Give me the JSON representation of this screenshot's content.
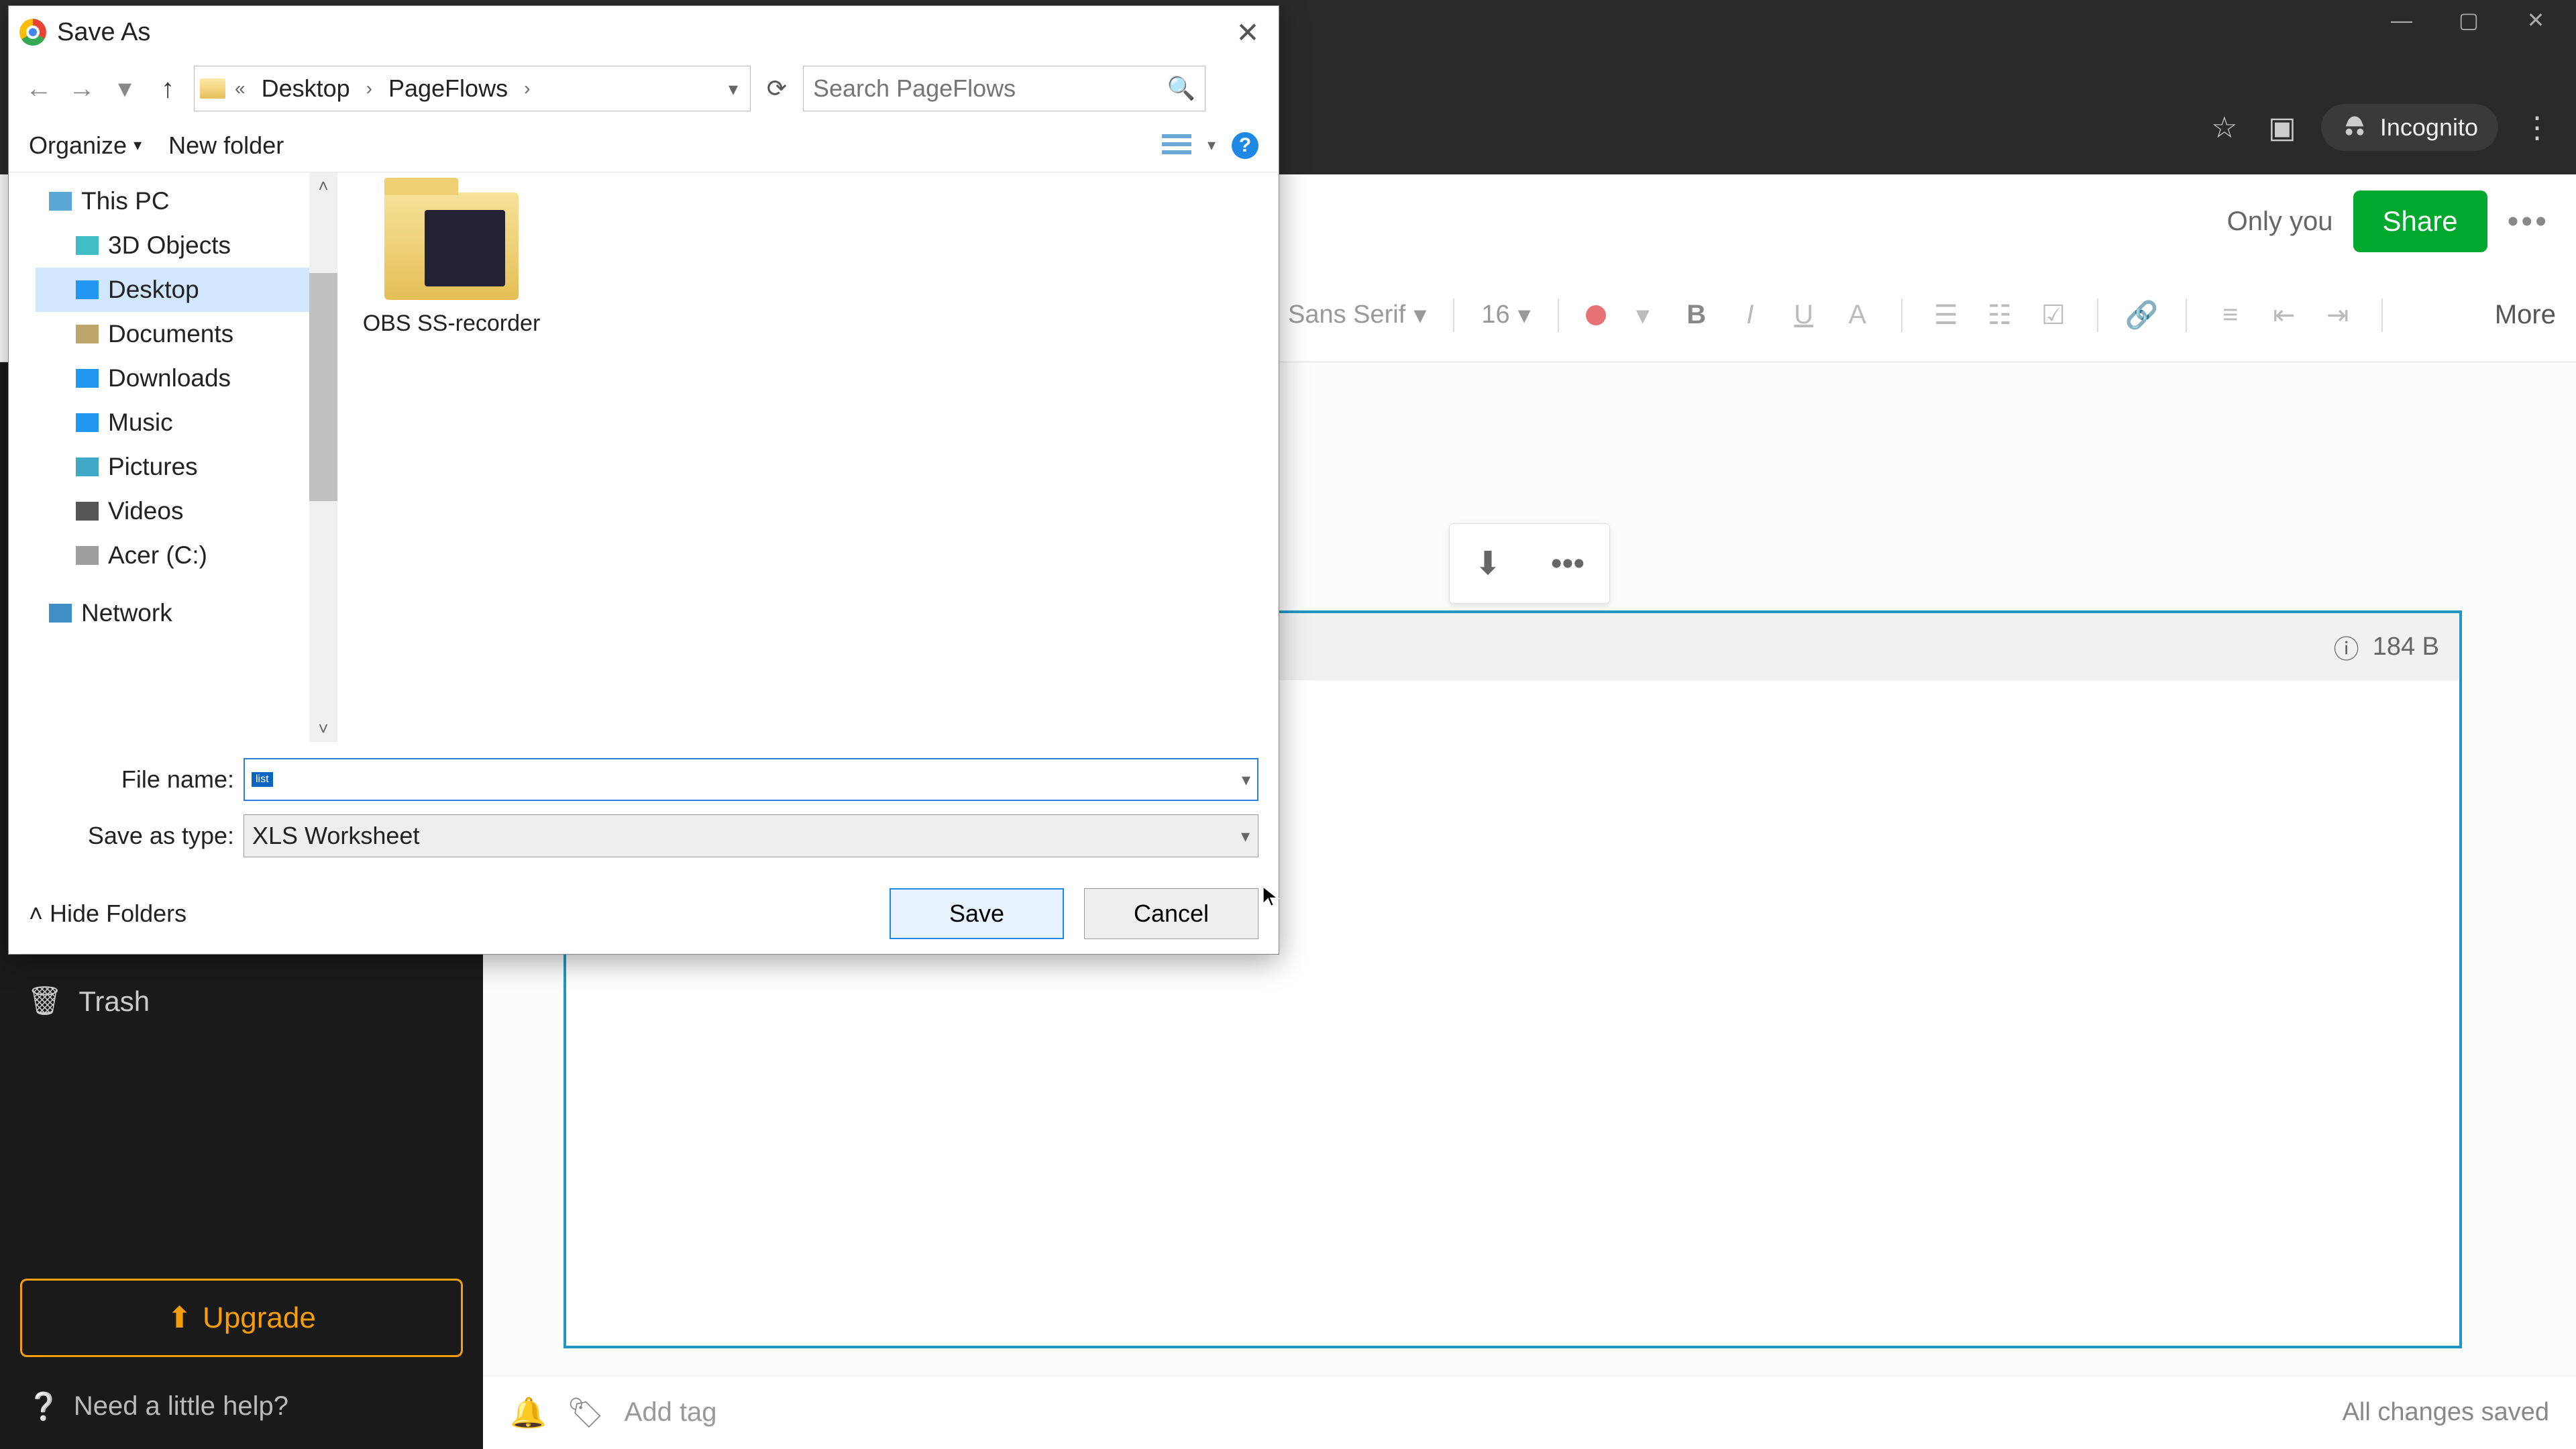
{
  "browser": {
    "incognito_label": "Incognito"
  },
  "app": {
    "only_you": "Only you",
    "share": "Share",
    "font_family": "Sans Serif",
    "font_size": "16",
    "more": "More",
    "attach_size": "184 B",
    "add_tag_placeholder": "Add tag",
    "saved_status": "All changes saved"
  },
  "sidebar": {
    "trash": "Trash",
    "upgrade": "Upgrade",
    "help": "Need a little help?"
  },
  "dialog": {
    "title": "Save As",
    "breadcrumbs": {
      "b1": "Desktop",
      "b2": "PageFlows"
    },
    "search_placeholder": "Search PageFlows",
    "organize": "Organize",
    "new_folder": "New folder",
    "tree": {
      "this_pc": "This PC",
      "objects3d": "3D Objects",
      "desktop": "Desktop",
      "documents": "Documents",
      "downloads": "Downloads",
      "music": "Music",
      "pictures": "Pictures",
      "videos": "Videos",
      "drive": "Acer (C:)",
      "network": "Network"
    },
    "folder_item": "OBS SS-recorder",
    "file_name_label": "File name:",
    "file_name_value": "list",
    "save_type_label": "Save as type:",
    "save_type_value": "XLS Worksheet",
    "hide_folders": "Hide Folders",
    "save": "Save",
    "cancel": "Cancel"
  }
}
